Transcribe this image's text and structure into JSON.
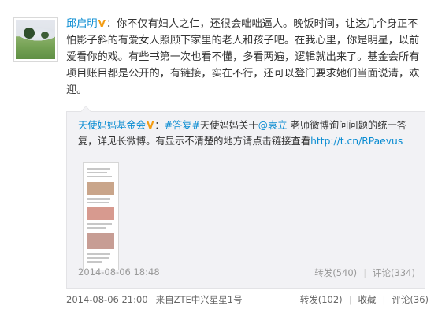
{
  "post": {
    "author": "邱启明",
    "body": "：你不仅有妇人之仁，还很会咄咄逼人。晚饭时间，让这几个身正不怕影子斜的有爱女人照顾下家里的老人和孩子吧。在我心里，你是明星，以前爱看你的戏。有些书第一次也看不懂，多看两遍，逻辑就出来了。基金会所有项目账目都是公开的，有链接，实在不行，还可以登门要求她们当面说清，欢迎。",
    "timestamp": "2014-08-06 21:00",
    "source": "来自ZTE中兴星星1号",
    "actions": {
      "repost": "转发(102)",
      "favorite": "收藏",
      "comment": "评论(36)"
    }
  },
  "repost": {
    "author": "天使妈妈基金会",
    "hashtag": "#答复#",
    "text_before_mention": "天使妈妈关于",
    "mention": "@袁立",
    "text_after_mention": " 老师微博询问问题的统一答复，详见长微博。有显示不清楚的地方请点击链接查看",
    "url": "http://t.cn/RPaevus",
    "timestamp": "2014-08-06 18:48",
    "actions": {
      "repost": "转发(540)",
      "comment": "评论(334)"
    }
  },
  "icons": {
    "verified_badge": "verified-v-icon"
  },
  "colors": {
    "link": "#0a8cd2",
    "verified": "#f39c12",
    "repost_bg": "#f2f2f5"
  }
}
